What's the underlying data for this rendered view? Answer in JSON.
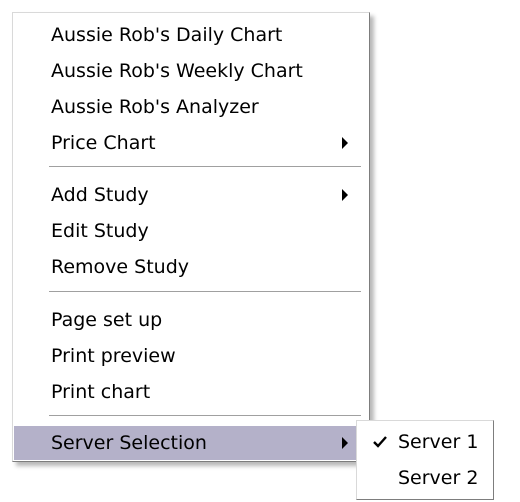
{
  "context_menu": {
    "items": [
      {
        "label": "Aussie Rob's Daily Chart"
      },
      {
        "label": "Aussie Rob's Weekly Chart"
      },
      {
        "label": "Aussie Rob's Analyzer"
      },
      {
        "label": "Price Chart",
        "has_submenu": true
      },
      {
        "label": "Add Study",
        "has_submenu": true
      },
      {
        "label": "Edit Study"
      },
      {
        "label": "Remove Study"
      },
      {
        "label": "Page set up"
      },
      {
        "label": "Print preview"
      },
      {
        "label": "Print chart"
      },
      {
        "label": "Server Selection",
        "has_submenu": true,
        "highlighted": true
      }
    ],
    "highlight_color": "#b4b1c9"
  },
  "server_submenu": {
    "items": [
      {
        "label": "Server 1",
        "checked": true,
        "icon": "check-icon"
      },
      {
        "label": "Server 2",
        "checked": false
      }
    ]
  }
}
